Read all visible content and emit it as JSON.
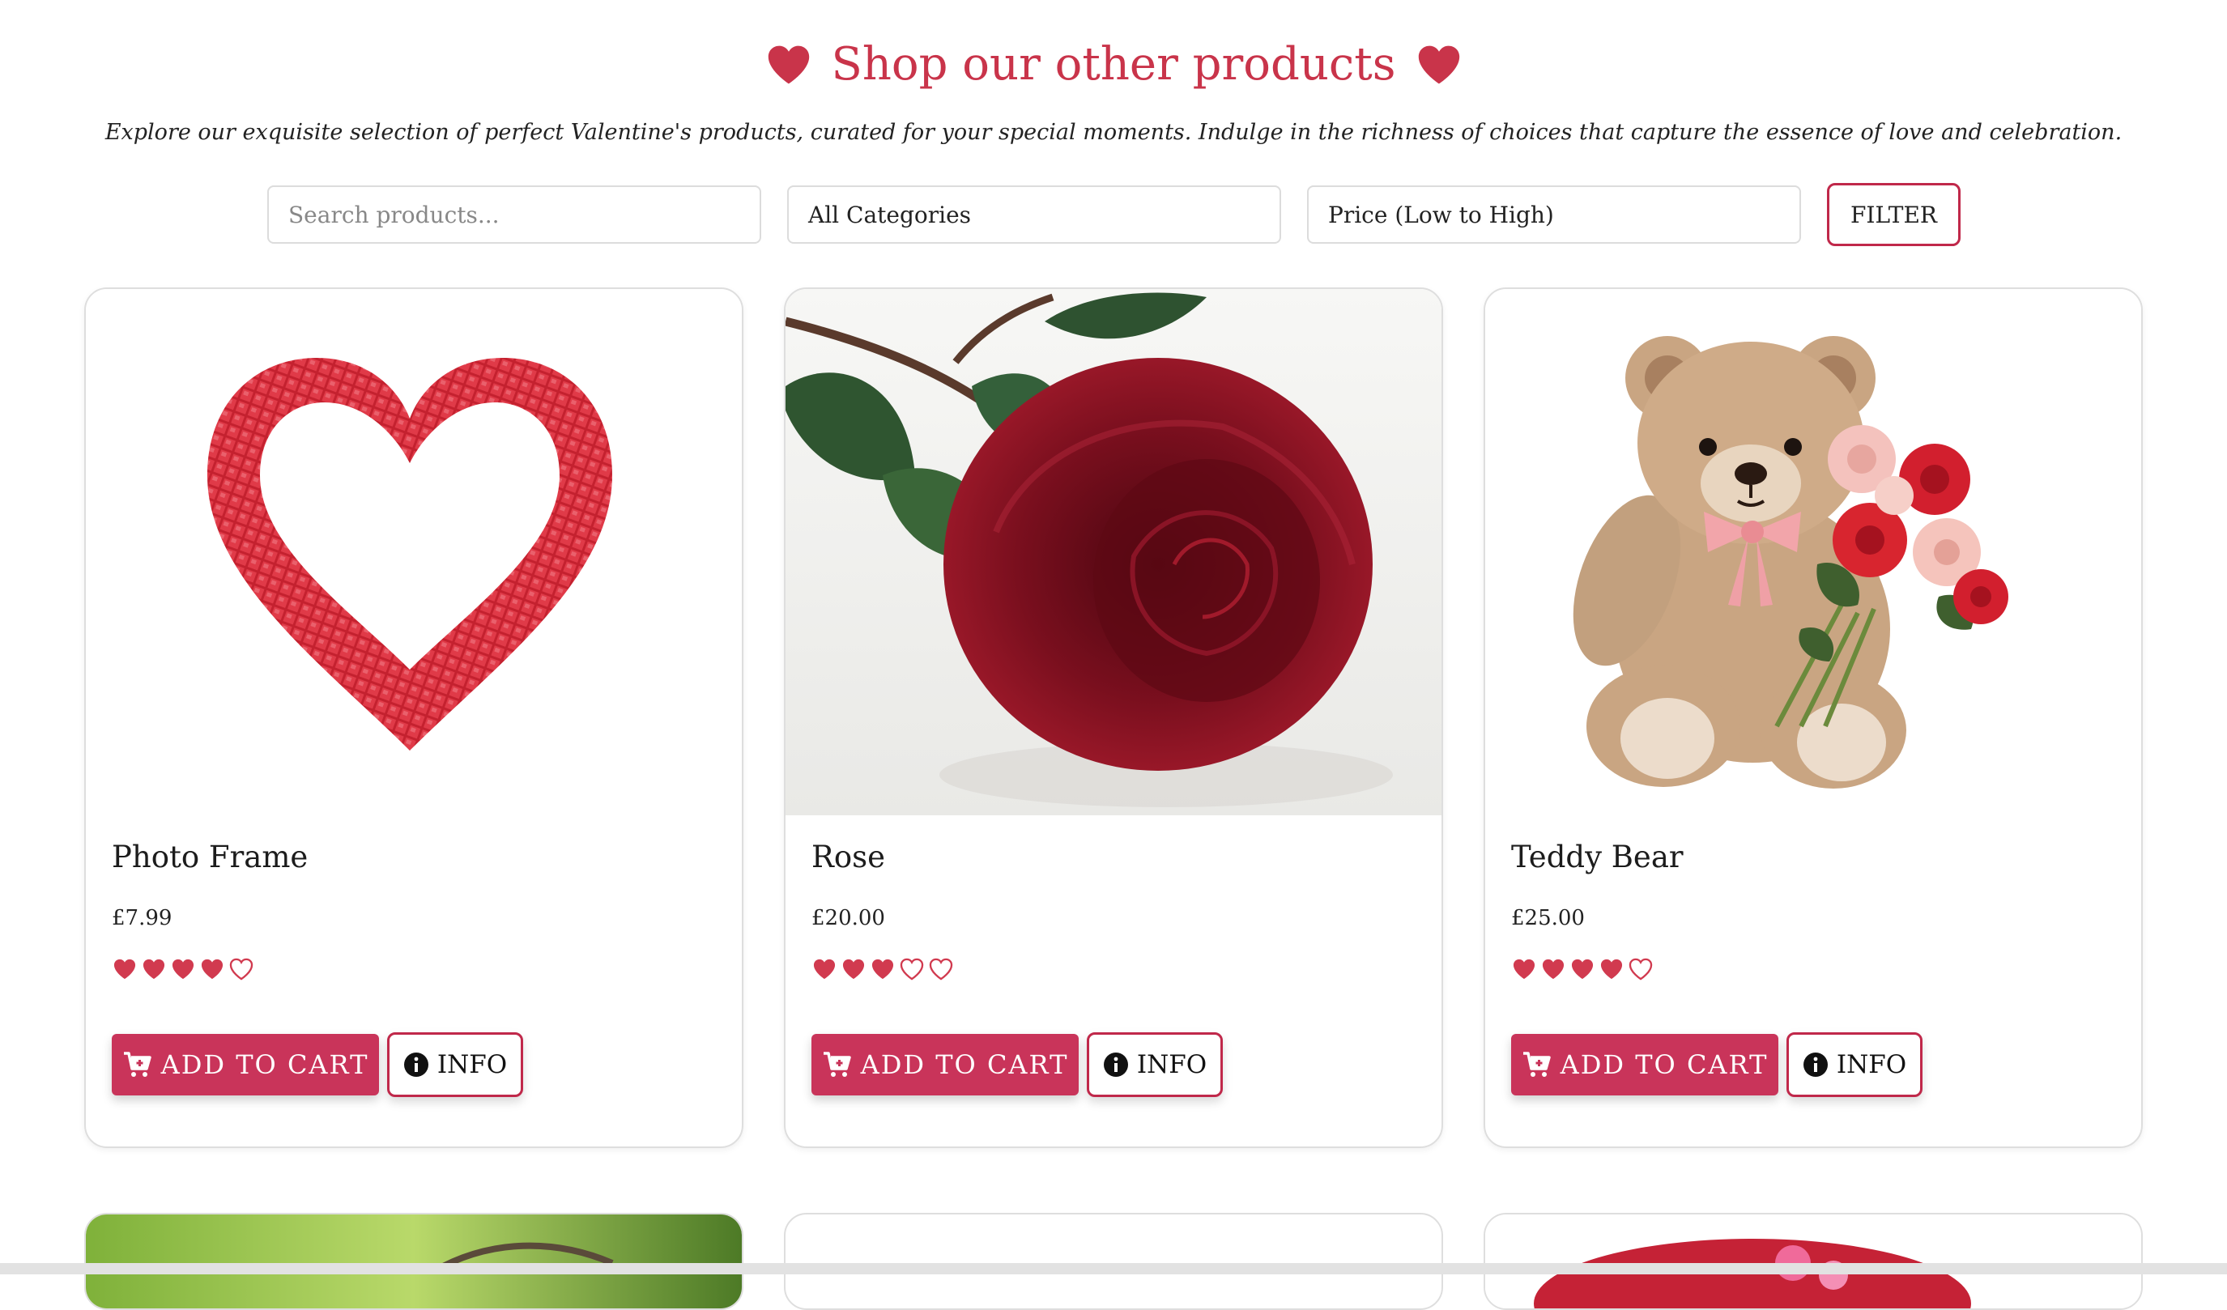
{
  "header": {
    "title": "Shop our other products",
    "subtitle": "Explore our exquisite selection of perfect Valentine's products, curated for your special moments. Indulge in the richness of choices that capture the essence of love and celebration."
  },
  "filters": {
    "search_placeholder": "Search products...",
    "category_value": "All Categories",
    "sort_value": "Price (Low to High)",
    "filter_label": "FILTER"
  },
  "colors": {
    "accent": "#c9344a",
    "button": "#c9345a",
    "heart": "#d13a4f"
  },
  "products": [
    {
      "name": "Photo Frame",
      "price": "£7.99",
      "rating": 4,
      "rating_max": 5,
      "cart_label": "ADD TO CART",
      "info_label": "INFO",
      "image": "heart-mosaic-frame"
    },
    {
      "name": "Rose",
      "price": "£20.00",
      "rating": 3,
      "rating_max": 5,
      "cart_label": "ADD TO CART",
      "info_label": "INFO",
      "image": "red-rose"
    },
    {
      "name": "Teddy Bear",
      "price": "£25.00",
      "rating": 4,
      "rating_max": 5,
      "cart_label": "ADD TO CART",
      "info_label": "INFO",
      "image": "teddy-bear-with-roses"
    }
  ]
}
